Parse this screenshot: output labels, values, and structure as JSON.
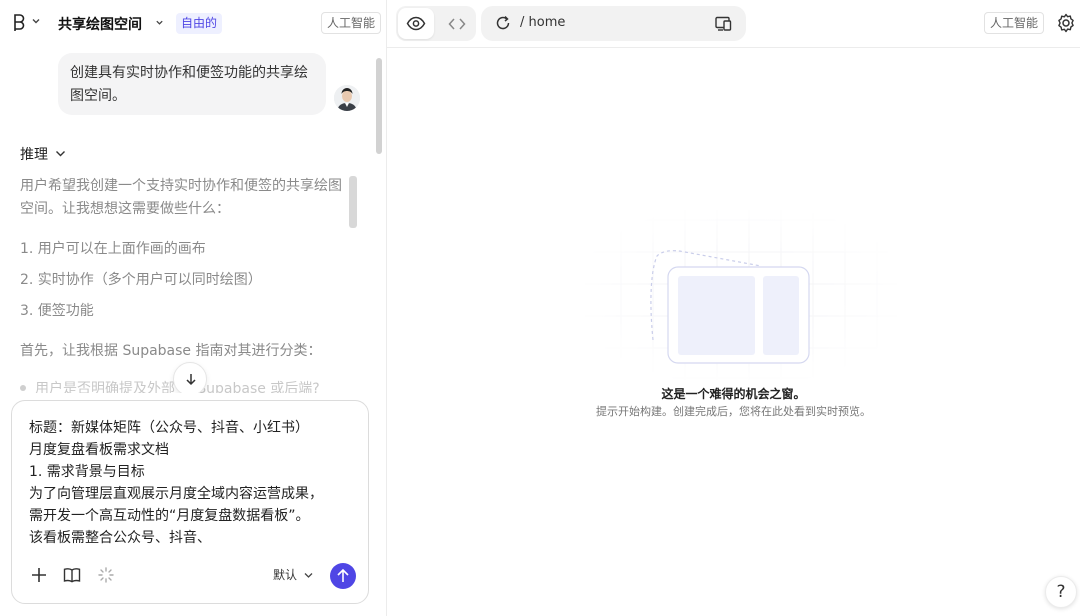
{
  "header_left": {
    "workspace_name": "共享绘图空间",
    "plan_badge": "自由的",
    "ai_badge": "人工智能"
  },
  "chat": {
    "user_message": "创建具有实时协作和便签功能的共享绘图空间。",
    "reasoning_label": "推理",
    "reasoning_intro": "用户希望我创建一个支持实时协作和便签的共享绘图空间。让我想想这需要做些什么：",
    "reasoning_list": [
      "1. 用户可以在上面作画的画布",
      "2. 实时协作（多个用户可以同时绘图）",
      "3. 便签功能"
    ],
    "reasoning_next": "首先，让我根据 Supabase 指南对其进行分类：",
    "reasoning_faded": "用户是否明确提及外部 ... Supabase 或后端?"
  },
  "composer": {
    "lines": [
      "标题：新媒体矩阵（公众号、抖音、小红书）",
      "月度复盘看板需求文档",
      "1. 需求背景与目标",
      "为了向管理层直观展示月度全域内容运营成果，",
      "需开发一个高互动性的“月度复盘数据看板”。",
      "该看板需整合公众号、抖音、"
    ],
    "model": "默认",
    "icons": [
      "plus-icon",
      "book-icon",
      "sparkle-icon",
      "arrow-up-icon"
    ],
    "send_color": "#4f46e5"
  },
  "header_right": {
    "url": "/ home",
    "ai_badge": "人工智能",
    "icons": [
      "eye-icon",
      "code-icon",
      "reload-icon",
      "devices-icon",
      "gear-icon"
    ]
  },
  "preview": {
    "empty_title": "这是一个难得的机会之窗。",
    "empty_subtitle": "提示开始构建。创建完成后，您将在此处看到实时预览。",
    "help": "?"
  }
}
